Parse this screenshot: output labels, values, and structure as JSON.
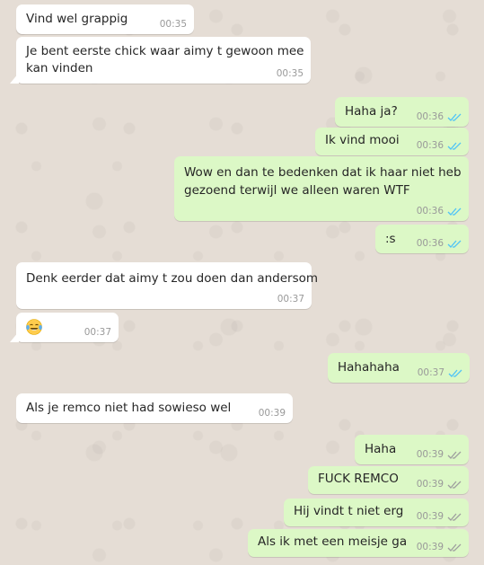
{
  "colors": {
    "background": "#e5ddd5",
    "incoming_bubble": "#ffffff",
    "outgoing_bubble": "#dcf8c6",
    "read_ticks": "#4fc3f7",
    "delivered_ticks": "#9e9e9e",
    "timestamp": "#999999"
  },
  "messages": [
    {
      "direction": "in",
      "text": "Vind wel grappig",
      "time": "00:35"
    },
    {
      "direction": "in",
      "text_line1": "Je bent eerste chick waar aimy t gewoon mee",
      "text_line2": "kan vinden",
      "time": "00:35"
    },
    {
      "direction": "out",
      "text": "Haha ja?",
      "time": "00:36",
      "ticks": "double-check-icon-read"
    },
    {
      "direction": "out",
      "text": "Ik vind mooi",
      "time": "00:36",
      "ticks": "double-check-icon-read"
    },
    {
      "direction": "out",
      "text_line1": "Wow en dan te bedenken dat ik haar niet heb",
      "text_line2": "gezoend terwijl we alleen waren WTF",
      "time": "00:36",
      "ticks": "double-check-icon-read"
    },
    {
      "direction": "out",
      "text": ":s",
      "time": "00:36",
      "ticks": "double-check-icon-read"
    },
    {
      "direction": "in",
      "text": "Denk eerder dat aimy t zou doen dan andersom",
      "time": "00:37"
    },
    {
      "direction": "in",
      "emoji": "laughing-tears-emoji",
      "time": "00:37"
    },
    {
      "direction": "out",
      "text": "Hahahaha",
      "time": "00:37",
      "ticks": "double-check-icon-read"
    },
    {
      "direction": "in",
      "text": "Als je remco niet had sowieso wel",
      "time": "00:39"
    },
    {
      "direction": "out",
      "text": "Haha",
      "time": "00:39",
      "ticks": "double-check-icon-delivered"
    },
    {
      "direction": "out",
      "text": "FUCK REMCO",
      "time": "00:39",
      "ticks": "double-check-icon-delivered"
    },
    {
      "direction": "out",
      "text": "Hij vindt t niet erg",
      "time": "00:39",
      "ticks": "double-check-icon-delivered"
    },
    {
      "direction": "out",
      "text": "Als ik met een meisje ga",
      "time": "00:39",
      "ticks": "double-check-icon-delivered"
    }
  ]
}
